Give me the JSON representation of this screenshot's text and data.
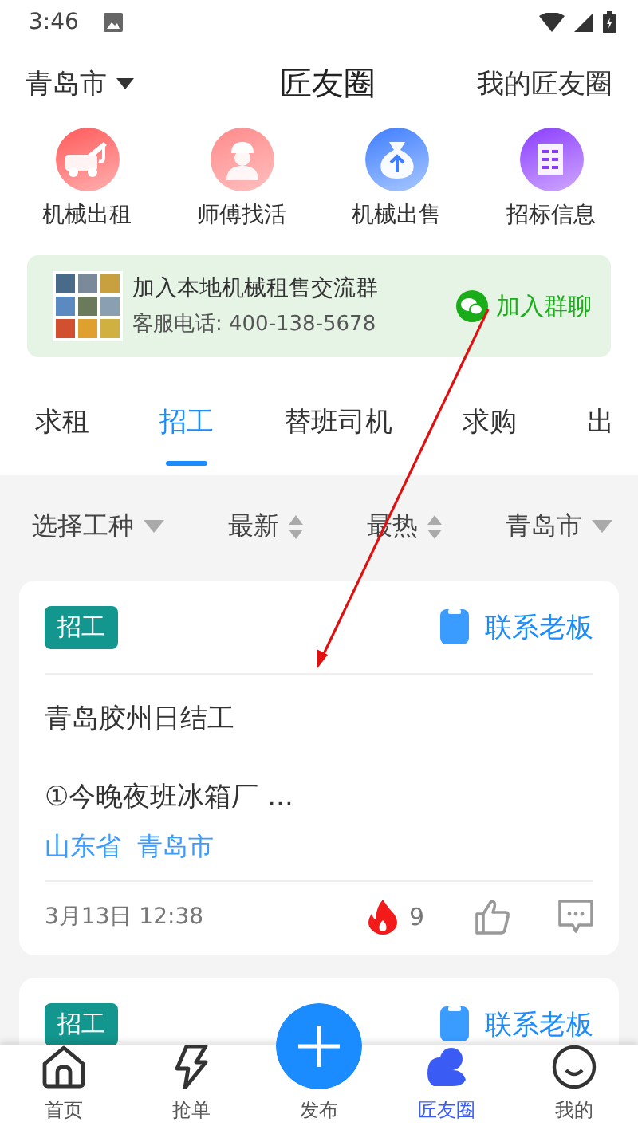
{
  "status_bar": {
    "time": "3:46"
  },
  "header": {
    "city": "青岛市",
    "title": "匠友圈",
    "my_link": "我的匠友圈"
  },
  "shortcuts": [
    {
      "label": "机械出租",
      "kind": "crane"
    },
    {
      "label": "师傅找活",
      "kind": "worker"
    },
    {
      "label": "机械出售",
      "kind": "sale"
    },
    {
      "label": "招标信息",
      "kind": "tender"
    }
  ],
  "banner": {
    "title": "加入本地机械租售交流群",
    "phone": "客服电话: 400-138-5678",
    "action": "加入群聊"
  },
  "tabs": [
    {
      "label": "求租",
      "selected": false
    },
    {
      "label": "招工",
      "selected": true
    },
    {
      "label": "替班司机",
      "selected": false
    },
    {
      "label": "求购",
      "selected": false
    },
    {
      "label": "出",
      "selected": false
    }
  ],
  "filters": [
    {
      "label": "选择工种",
      "kind": "dropdown"
    },
    {
      "label": "最新",
      "kind": "sort"
    },
    {
      "label": "最热",
      "kind": "sort"
    },
    {
      "label": "青岛市",
      "kind": "dropdown"
    }
  ],
  "posts": [
    {
      "tag": "招工",
      "contact": "联系老板",
      "title": "青岛胶州日结工",
      "body": "①今晚夜班冰箱厂 ...",
      "location": [
        "山东省",
        "青岛市"
      ],
      "time": "3月13日 12:38",
      "hot": "9"
    },
    {
      "tag": "招工",
      "contact": "联系老板"
    }
  ],
  "bottom_nav": [
    {
      "label": "首页",
      "kind": "home",
      "selected": false
    },
    {
      "label": "抢单",
      "kind": "bolt",
      "selected": false
    },
    {
      "label": "发布",
      "kind": "publish",
      "selected": false
    },
    {
      "label": "匠友圈",
      "kind": "circle",
      "selected": true
    },
    {
      "label": "我的",
      "kind": "me",
      "selected": false
    }
  ]
}
